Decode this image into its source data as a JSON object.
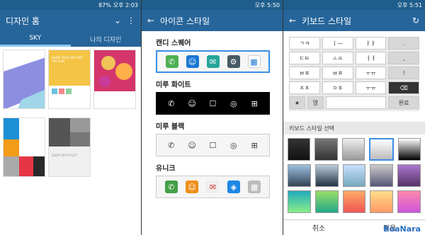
{
  "status": {
    "left_time": "오후 2:03",
    "left_battery": "87%",
    "mid_time": "오후 5:50",
    "right_time": "오후 5:51"
  },
  "panel1": {
    "title": "디자인 홈",
    "tabs": [
      "SKY",
      "나의 디자인"
    ],
    "thumb_texts": {
      "t1": "SHINE YOUR DAY LIKE THE SUN",
      "t2": "ENJOY SPOTLIGHT"
    }
  },
  "panel2": {
    "title": "아이콘 스타일",
    "sections": [
      "캔디 스퀘어",
      "미루 화이트",
      "미루 블랙",
      "유니크"
    ]
  },
  "panel3": {
    "title": "키보드 스타일",
    "section_label": "키보드 스타일 선택",
    "cancel": "취소",
    "apply": "적용",
    "watermark": "BoaNara",
    "keys": [
      [
        "ㄱㅋ",
        "ㅣ—",
        "ㅏㅑ",
        "."
      ],
      [
        "ㄷㅌ",
        "ㅗㅛ",
        "ㅓㅕ",
        ","
      ],
      [
        "ㅂㅍ",
        "ㅂㅍ",
        "ㅜㅠ",
        "!"
      ],
      [
        "ㅈㅊ",
        "ㅇㅎ",
        "ㅜㅠ",
        "⌫"
      ]
    ],
    "bottom_keys": [
      "★",
      "영",
      "",
      "완료"
    ]
  },
  "colors": {
    "accent": "#26659a"
  }
}
